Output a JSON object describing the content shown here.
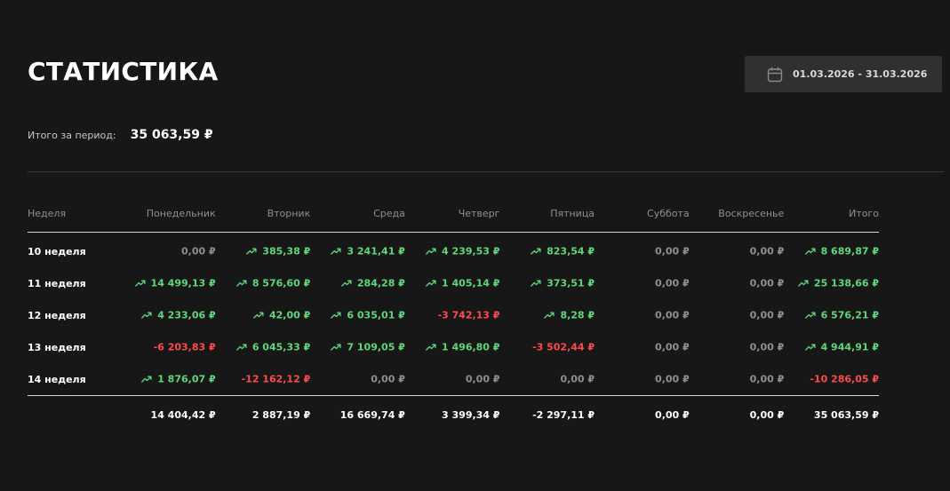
{
  "page": {
    "title": "СТАТИСТИКА"
  },
  "date_range": {
    "icon": "calendar-icon",
    "label": "01.03.2026 - 31.03.2026"
  },
  "summary": {
    "label": "Итого за период:",
    "value": "35 063,59 ₽"
  },
  "colors": {
    "positive": "#5fd77b",
    "negative": "#ff4a4a",
    "neutral": "#8f8f8f",
    "background": "#171717",
    "button_bg": "#303030"
  },
  "table": {
    "headers": [
      "Неделя",
      "Понедельник",
      "Вторник",
      "Среда",
      "Четверг",
      "Пятница",
      "Суббота",
      "Воскресенье",
      "Итого"
    ],
    "rows": [
      {
        "week": "10 неделя",
        "cells": [
          {
            "value": "0,00 ₽",
            "trend": "zero"
          },
          {
            "value": "385,38 ₽",
            "trend": "pos"
          },
          {
            "value": "3 241,41 ₽",
            "trend": "pos"
          },
          {
            "value": "4 239,53 ₽",
            "trend": "pos"
          },
          {
            "value": "823,54 ₽",
            "trend": "pos"
          },
          {
            "value": "0,00 ₽",
            "trend": "zero"
          },
          {
            "value": "0,00 ₽",
            "trend": "zero"
          },
          {
            "value": "8 689,87 ₽",
            "trend": "pos"
          }
        ]
      },
      {
        "week": "11 неделя",
        "cells": [
          {
            "value": "14 499,13 ₽",
            "trend": "pos"
          },
          {
            "value": "8 576,60 ₽",
            "trend": "pos"
          },
          {
            "value": "284,28 ₽",
            "trend": "pos"
          },
          {
            "value": "1 405,14 ₽",
            "trend": "pos"
          },
          {
            "value": "373,51 ₽",
            "trend": "pos"
          },
          {
            "value": "0,00 ₽",
            "trend": "zero"
          },
          {
            "value": "0,00 ₽",
            "trend": "zero"
          },
          {
            "value": "25 138,66 ₽",
            "trend": "pos"
          }
        ]
      },
      {
        "week": "12 неделя",
        "cells": [
          {
            "value": "4 233,06 ₽",
            "trend": "pos"
          },
          {
            "value": "42,00 ₽",
            "trend": "pos"
          },
          {
            "value": "6 035,01 ₽",
            "trend": "pos"
          },
          {
            "value": "-3 742,13 ₽",
            "trend": "neg"
          },
          {
            "value": "8,28 ₽",
            "trend": "pos"
          },
          {
            "value": "0,00 ₽",
            "trend": "zero"
          },
          {
            "value": "0,00 ₽",
            "trend": "zero"
          },
          {
            "value": "6 576,21 ₽",
            "trend": "pos"
          }
        ]
      },
      {
        "week": "13 неделя",
        "cells": [
          {
            "value": "-6 203,83 ₽",
            "trend": "neg"
          },
          {
            "value": "6 045,33 ₽",
            "trend": "pos"
          },
          {
            "value": "7 109,05 ₽",
            "trend": "pos"
          },
          {
            "value": "1 496,80 ₽",
            "trend": "pos"
          },
          {
            "value": "-3 502,44 ₽",
            "trend": "neg"
          },
          {
            "value": "0,00 ₽",
            "trend": "zero"
          },
          {
            "value": "0,00 ₽",
            "trend": "zero"
          },
          {
            "value": "4 944,91 ₽",
            "trend": "pos"
          }
        ]
      },
      {
        "week": "14 неделя",
        "cells": [
          {
            "value": "1 876,07 ₽",
            "trend": "pos"
          },
          {
            "value": "-12 162,12 ₽",
            "trend": "neg"
          },
          {
            "value": "0,00 ₽",
            "trend": "zero"
          },
          {
            "value": "0,00 ₽",
            "trend": "zero"
          },
          {
            "value": "0,00 ₽",
            "trend": "zero"
          },
          {
            "value": "0,00 ₽",
            "trend": "zero"
          },
          {
            "value": "0,00 ₽",
            "trend": "zero"
          },
          {
            "value": "-10 286,05 ₽",
            "trend": "neg"
          }
        ]
      }
    ],
    "totals": [
      "14 404,42 ₽",
      "2 887,19 ₽",
      "16 669,74 ₽",
      "3 399,34 ₽",
      "-2 297,11 ₽",
      "0,00 ₽",
      "0,00 ₽",
      "35 063,59 ₽"
    ]
  }
}
